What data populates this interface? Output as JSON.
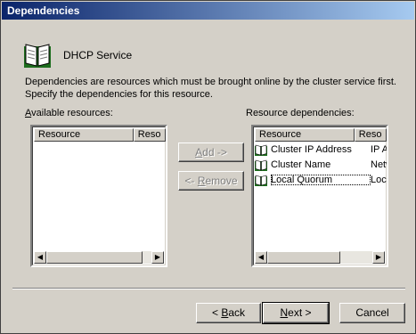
{
  "window": {
    "title": "Dependencies"
  },
  "header": {
    "title": "DHCP Service",
    "icon": "book-icon"
  },
  "description": "Dependencies are resources which must be brought online by the cluster service first. Specify the dependencies for this resource.",
  "available": {
    "label_accel": "A",
    "label_rest": "vailable resources:",
    "columns": [
      "Resource",
      "Reso"
    ]
  },
  "dependencies": {
    "label": "Resource dependencies:",
    "columns": [
      "Resource",
      "Reso"
    ],
    "rows": [
      {
        "name": "Cluster IP Address",
        "type": "IP Ac",
        "icon": "resource-book-icon"
      },
      {
        "name": "Cluster Name",
        "type": "Netw",
        "icon": "resource-book-icon"
      },
      {
        "name": "Local Quorum",
        "type": "Loca",
        "icon": "resource-book-icon"
      }
    ]
  },
  "buttons": {
    "add": {
      "accel": "A",
      "rest": "dd ->"
    },
    "remove": {
      "pre": "<- ",
      "accel": "R",
      "rest": "emove"
    },
    "back": {
      "pre": "< ",
      "accel": "B",
      "rest": "ack"
    },
    "next": {
      "accel": "N",
      "rest": "ext >"
    },
    "cancel": "Cancel"
  }
}
